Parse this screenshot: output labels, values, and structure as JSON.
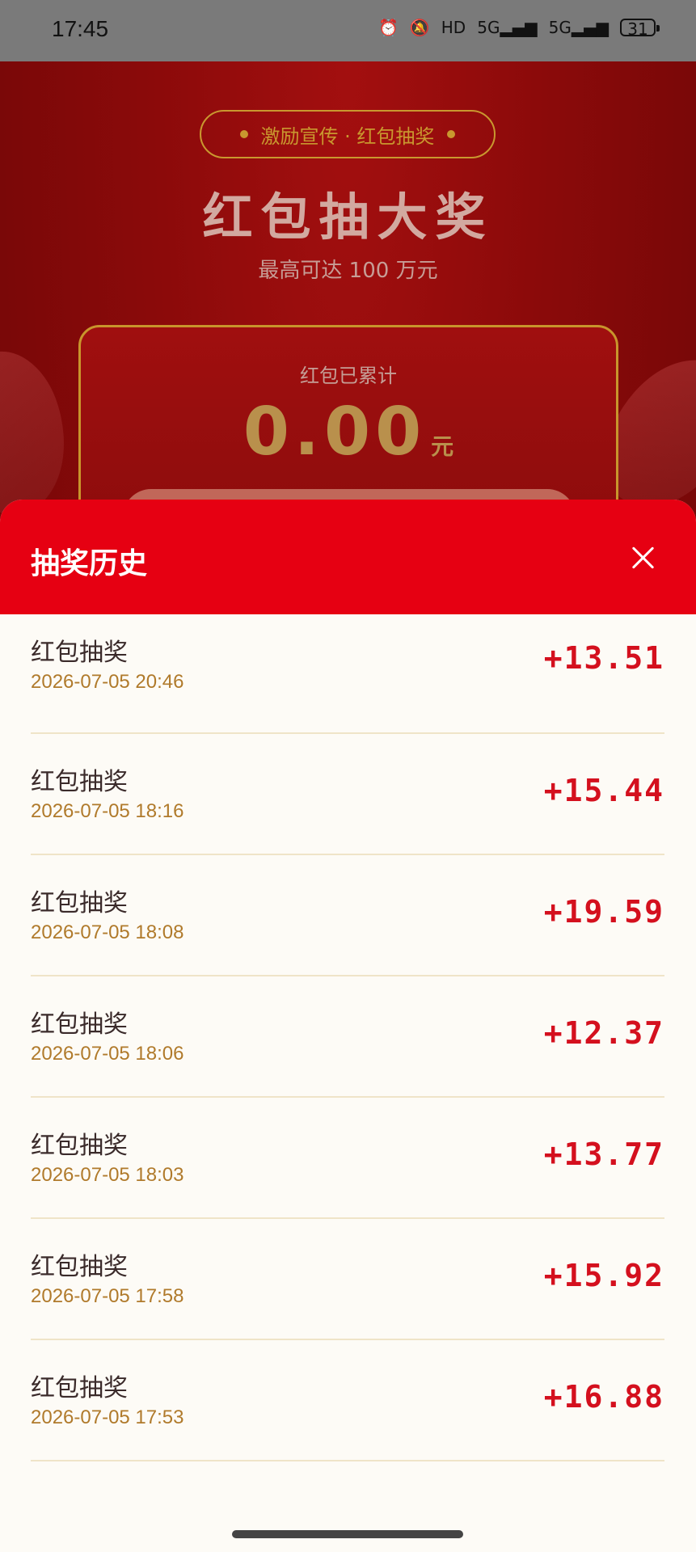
{
  "status_bar": {
    "time": "17:45",
    "icons": [
      "alarm-icon",
      "mute-icon",
      "hd-icon",
      "signal-5g-icon",
      "signal-5g-icon",
      "battery-icon"
    ],
    "hd_label": "HD",
    "net1": "5G",
    "net2": "5G",
    "battery": "31"
  },
  "background": {
    "tag": "激励宣传 · 红包抽奖",
    "title": "红包抽大奖",
    "subtitle": "最高可达 100 万元",
    "accum_label": "红包已累计",
    "accum_amount": "0.00",
    "accum_unit": "元"
  },
  "sheet": {
    "title": "抽奖历史",
    "items": [
      {
        "title": "红包抽奖",
        "time": "2026-07-05 20:46",
        "amount": "+13.51"
      },
      {
        "title": "红包抽奖",
        "time": "2026-07-05 18:16",
        "amount": "+15.44"
      },
      {
        "title": "红包抽奖",
        "time": "2026-07-05 18:08",
        "amount": "+19.59"
      },
      {
        "title": "红包抽奖",
        "time": "2026-07-05 18:06",
        "amount": "+12.37"
      },
      {
        "title": "红包抽奖",
        "time": "2026-07-05 18:03",
        "amount": "+13.77"
      },
      {
        "title": "红包抽奖",
        "time": "2026-07-05 17:58",
        "amount": "+15.92"
      },
      {
        "title": "红包抽奖",
        "time": "2026-07-05 17:53",
        "amount": "+16.88"
      }
    ]
  },
  "colors": {
    "header_red": "#e60012",
    "amount_red": "#d4101e",
    "gold": "#c9982f",
    "time_brown": "#b07a2b"
  }
}
